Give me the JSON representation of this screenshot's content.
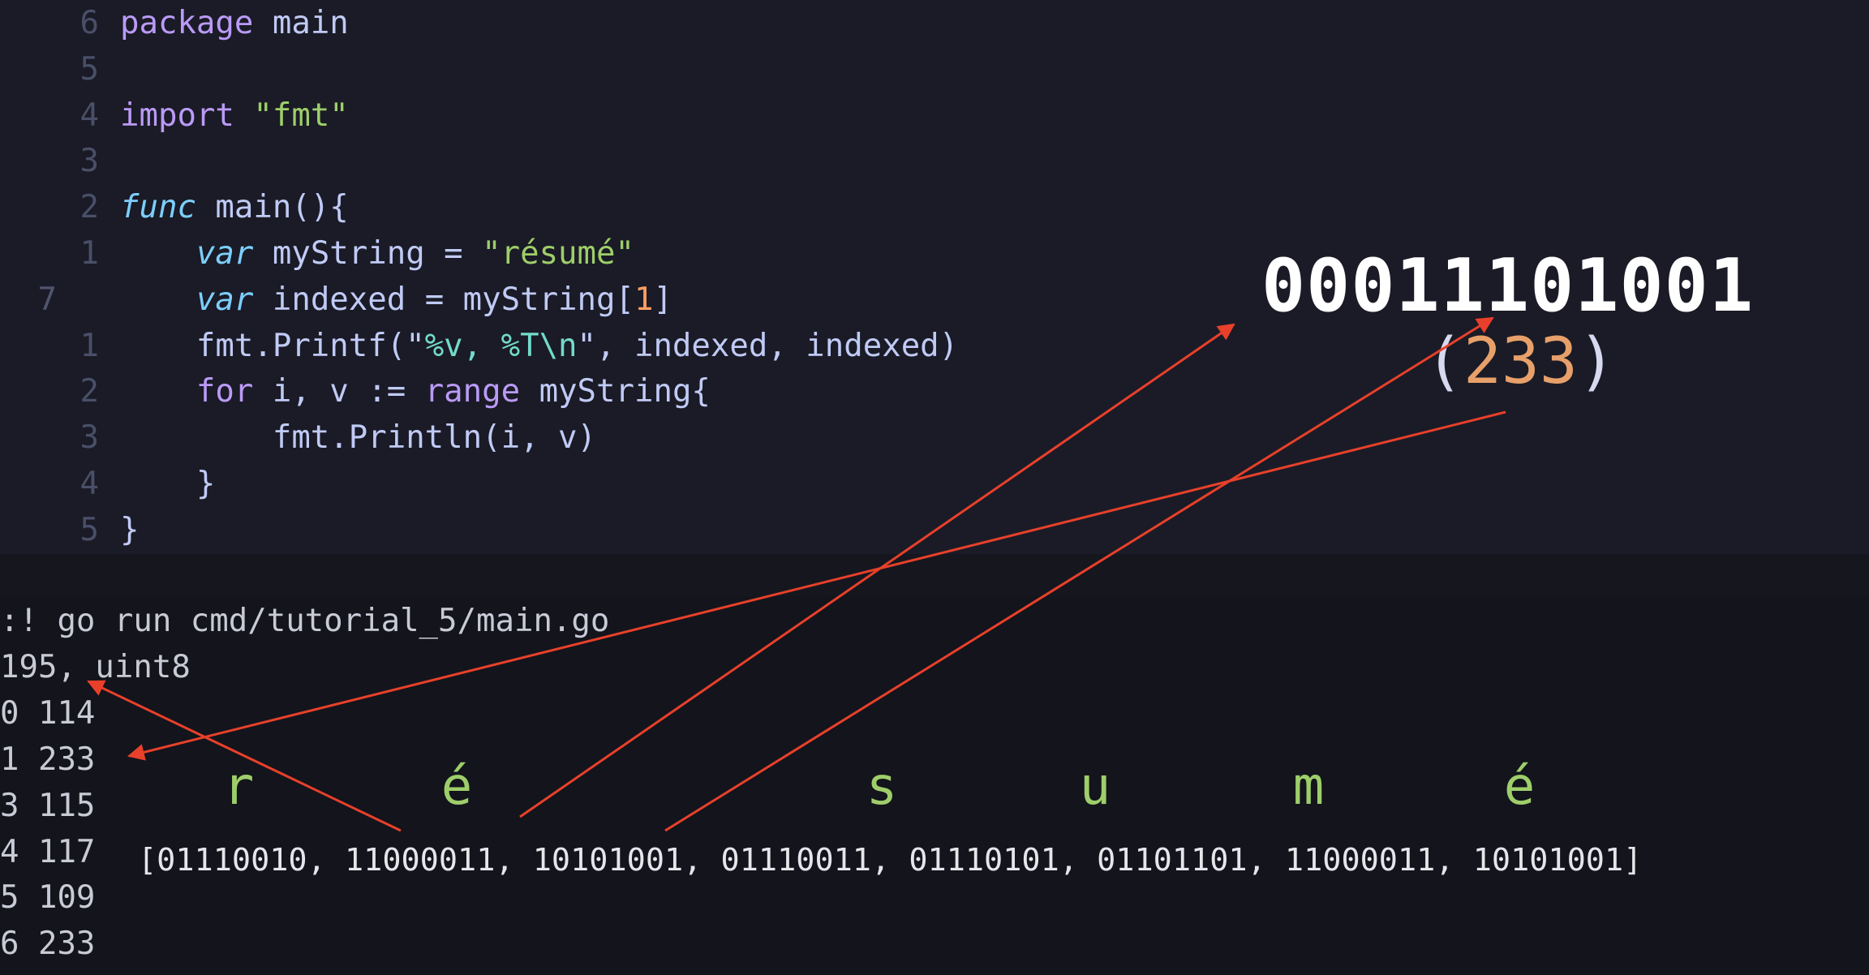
{
  "editor": {
    "lines": [
      {
        "num": "6",
        "tokens": [
          {
            "t": "package",
            "c": "kw"
          },
          {
            "t": " main",
            "c": "df"
          }
        ]
      },
      {
        "num": "5",
        "tokens": []
      },
      {
        "num": "4",
        "tokens": [
          {
            "t": "import",
            "c": "kw"
          },
          {
            "t": " ",
            "c": "df"
          },
          {
            "t": "\"fmt\"",
            "c": "st"
          }
        ]
      },
      {
        "num": "3",
        "tokens": []
      },
      {
        "num": "2",
        "tokens": [
          {
            "t": "func",
            "c": "it"
          },
          {
            "t": " main(){",
            "c": "df"
          }
        ]
      },
      {
        "num": "1",
        "tokens": [
          {
            "t": "    ",
            "c": "df"
          },
          {
            "t": "var",
            "c": "it"
          },
          {
            "t": " myString = ",
            "c": "df"
          },
          {
            "t": "\"résumé\"",
            "c": "st"
          }
        ]
      },
      {
        "num": "7",
        "current": true,
        "tokens": [
          {
            "t": "    ",
            "c": "df"
          },
          {
            "t": "var",
            "c": "it"
          },
          {
            "t": " indexed = myString[",
            "c": "df"
          },
          {
            "t": "1",
            "c": "nm"
          },
          {
            "t": "]",
            "c": "df"
          }
        ]
      },
      {
        "num": "1",
        "tokens": [
          {
            "t": "    fmt.Printf(\"",
            "c": "df"
          },
          {
            "t": "%v, %T\\n",
            "c": "fmt"
          },
          {
            "t": "\", indexed, indexed)",
            "c": "df"
          }
        ]
      },
      {
        "num": "2",
        "tokens": [
          {
            "t": "    ",
            "c": "df"
          },
          {
            "t": "for",
            "c": "kw"
          },
          {
            "t": " i, v := ",
            "c": "df"
          },
          {
            "t": "range",
            "c": "kw"
          },
          {
            "t": " myString{",
            "c": "df"
          }
        ]
      },
      {
        "num": "3",
        "tokens": [
          {
            "t": "        fmt.Println(i, v)",
            "c": "df"
          }
        ]
      },
      {
        "num": "4",
        "tokens": [
          {
            "t": "    }",
            "c": "df"
          }
        ]
      },
      {
        "num": "5",
        "tokens": [
          {
            "t": "}",
            "c": "df"
          }
        ]
      }
    ]
  },
  "terminal": {
    "lines": [
      ":! go run cmd/tutorial_5/main.go",
      "195, uint8",
      "0 114",
      "1 233",
      "3 115",
      "4 117",
      "5 109",
      "6 233"
    ]
  },
  "annotation": {
    "letters": [
      "r",
      "é",
      "s",
      "u",
      "m",
      "é"
    ],
    "bytes": "[01110010, 11000011, 10101001, 01110011, 01110101, 01101101, 11000011, 10101001]",
    "binary": "00011101001",
    "decimal_open": "(",
    "decimal_value": "233",
    "decimal_close": ")",
    "arrow_color": "#e8402a"
  }
}
